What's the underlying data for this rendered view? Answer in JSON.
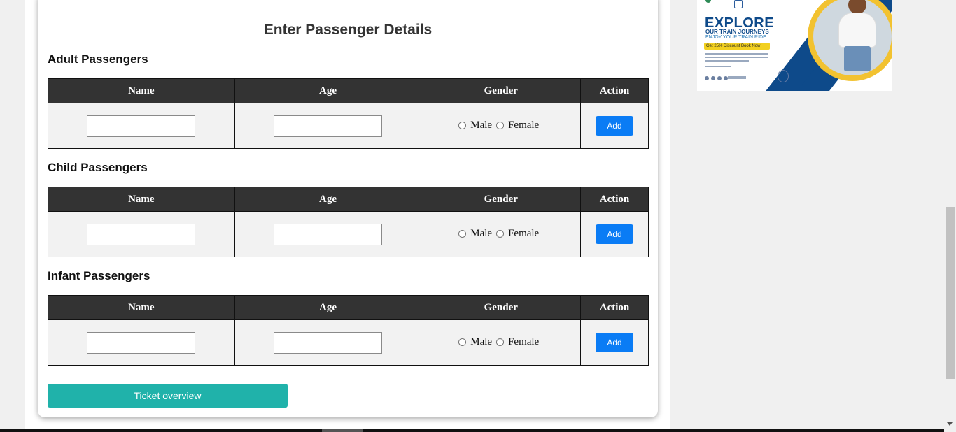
{
  "form": {
    "title": "Enter Passenger Details",
    "columns": [
      "Name",
      "Age",
      "Gender",
      "Action"
    ],
    "gender_options": [
      "Male",
      "Female"
    ],
    "add_label": "Add",
    "sections": [
      {
        "title": "Adult Passengers",
        "name_value": "",
        "age_value": ""
      },
      {
        "title": "Child Passengers",
        "name_value": "",
        "age_value": ""
      },
      {
        "title": "Infant Passengers",
        "name_value": "",
        "age_value": ""
      }
    ],
    "overview_button": "Ticket overview"
  },
  "ad": {
    "title": "EXPLORE",
    "subtitle": "OUR TRAIN JOURNEYS",
    "tagline": "ENJOY YOUR TRAIN RIDE",
    "promo": "Get 25% Discount Book Now"
  },
  "colors": {
    "header_bg": "#333333",
    "add_button": "#0a7cf5",
    "overview_button": "#20b2aa",
    "ad_blue": "#0e4a8a",
    "ad_yellow": "#f2c230"
  }
}
